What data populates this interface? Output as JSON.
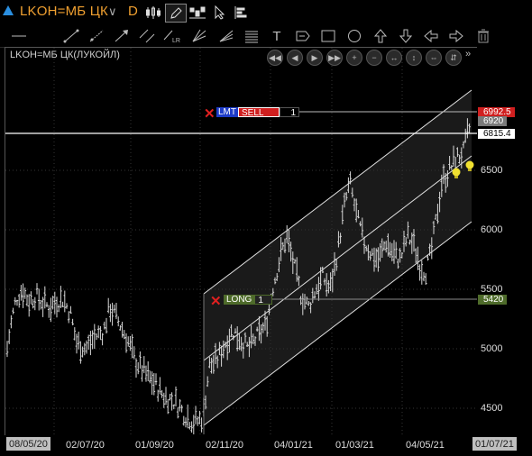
{
  "header": {
    "symbol": "LKOH=МБ ЦК",
    "period": "D"
  },
  "toolbar_icons": [
    "candlestick-icon",
    "pencil-icon",
    "bar-toggle-icon",
    "cursor-icon",
    "order-settings-icon"
  ],
  "drawing_tools": [
    "horizontal-line-icon",
    "trend-line-icon",
    "ray-icon",
    "arrow-line-icon",
    "parallel-lines-icon",
    "regression-channel-icon",
    "fan-icon",
    "fibonacci-icon",
    "fib-levels-icon",
    "text-tool-icon",
    "price-label-icon",
    "rectangle-icon",
    "ellipse-icon",
    "arrow-up-icon",
    "arrow-down-icon",
    "arrow-left-icon",
    "arrow-right-icon",
    "trash-icon"
  ],
  "text_tool_glyph": "T",
  "chart": {
    "title": "LKOH=МБ ЦК(ЛУКОЙЛ)",
    "y_ticks": [
      "6500",
      "6000",
      "5500",
      "5000",
      "4500"
    ],
    "x_ticks": [
      "02/07/20",
      "01/09/20",
      "02/11/20",
      "04/01/21",
      "01/03/21",
      "04/05/21"
    ],
    "x_start_label": "08/05/20",
    "x_end_label": "01/07/21",
    "ylim": [
      4330,
      7100
    ]
  },
  "price_labels": {
    "limit_price": "6992.5",
    "last_bid": "6920",
    "hline_price": "6815.4",
    "long_price": "5420"
  },
  "orders": {
    "limit_tag": "LMT",
    "sell_label": "SELL",
    "sell_qty": "1",
    "long_label": "LONG",
    "long_qty": "1"
  },
  "colors": {
    "symbol": "#f0a030",
    "limit_red": "#d01f1f",
    "long_green": "#4e6b2a",
    "lmt_blue": "#1e3cc8"
  }
}
